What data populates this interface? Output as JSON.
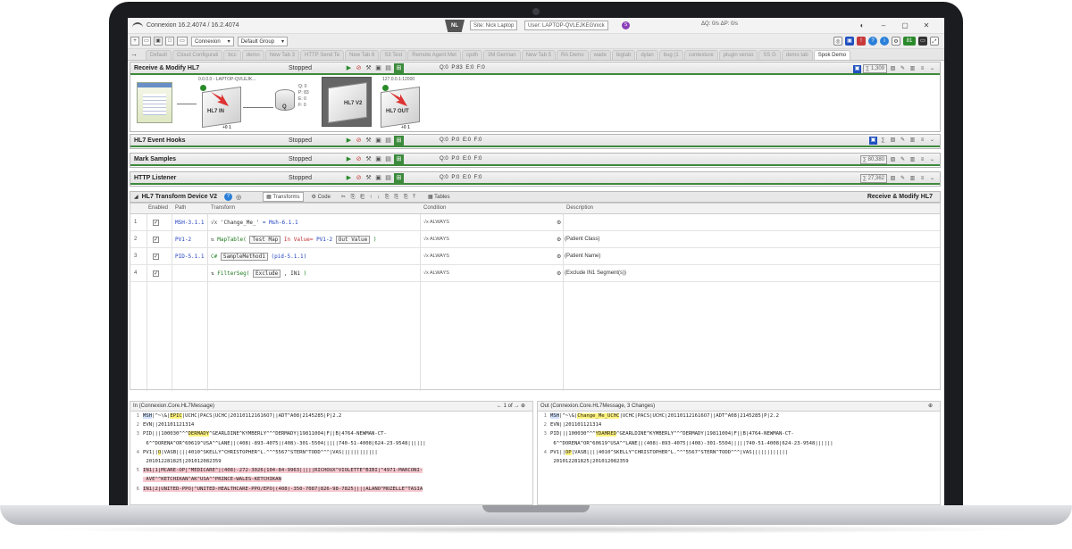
{
  "window": {
    "title": "Connexion 16.2.4074 / 16.2.4074",
    "env_badge": "NL",
    "site": "Site: Nick Laptop",
    "user": "User: LAPTOP-QVLEJKEG\\nick",
    "user_badge": "S",
    "rates": "ΔQ: 0/s   ΔP: 0/s"
  },
  "toolbar": {
    "site_select": "Connexion",
    "group_select": "Default Group"
  },
  "tabs": [
    "Default",
    "Cloud Configurati",
    "bcc",
    "demo",
    "New Tab 3",
    "HTTP Send Te",
    "New Tab 6",
    "S3 Test",
    "Remote Agent Met",
    "cpdh",
    "3M German",
    "New Tab 5",
    "RA Demo",
    "wade",
    "bigtab",
    "dylan",
    "bug (1",
    "contexture",
    "plugin versio",
    "SS G",
    "demo tab",
    "Spok Demo"
  ],
  "active_tab": "Spok Demo",
  "channels": [
    {
      "name": "Receive & Modify HL7",
      "status": "Stopped",
      "counts": "Q:0  P:83  E:0  F:0",
      "sum": "1,309",
      "flow": {
        "in_label": "0.0.0.0 - LAPTOP-QVLEJK...",
        "out_label": "127.0.0.1:12000",
        "in_text": "HL7 IN",
        "queue_text": "Q",
        "queue_stats": "Q: 0\nP: 83\nE: 0\nF: 0",
        "transform_text": "HL7 V2",
        "out_text": "HL7 OUT",
        "in_flag": "+0 1",
        "out_flag": "+0 1"
      }
    },
    {
      "name": "HL7 Event Hooks",
      "status": "Stopped",
      "counts": "Q:0  P:0  E:0  F:0",
      "sum": ""
    },
    {
      "name": "Mark Samples",
      "status": "Stopped",
      "counts": "Q:0  P:0  E:0  F:0",
      "sum": "80,380"
    },
    {
      "name": "HTTP Listener",
      "status": "Stopped",
      "counts": "Q:0  P:0  E:0  F:0",
      "sum": "27,362"
    }
  ],
  "transform_panel": {
    "title": "HL7 Transform Device V2",
    "tab_transforms": "Transforms",
    "tab_code": "Code",
    "tab_tables": "Tables",
    "channel_name": "Receive & Modify HL7",
    "columns": {
      "enabled": "Enabled",
      "path": "Path",
      "transform": "Transform",
      "condition": "Condition",
      "description": "Description"
    },
    "rows": [
      {
        "num": "1",
        "path": "MSH-3.1.1",
        "fx": "√x",
        "t1": "'Change_Me_'",
        "t2": "= Msh-6.1.1",
        "cond": "ALWAYS",
        "desc": ""
      },
      {
        "num": "2",
        "path": "PV1-2",
        "fx": "⇆",
        "t1": "MapTable(",
        "sel1": "Test Map",
        "t2": "In Value=",
        "t3": "PV1-2",
        "sel2": "Out Value",
        "t4": ")",
        "cond": "ALWAYS",
        "desc": "(Patient Class)"
      },
      {
        "num": "3",
        "path": "PID-5.1.1",
        "fx": "C#",
        "sel1": "SampleMethod1",
        "t2": "(pid-5.1.1)",
        "cond": "ALWAYS",
        "desc": "(Patient Name)"
      },
      {
        "num": "4",
        "path": "",
        "fx": "⇅",
        "t1": "FilterSeg(",
        "sel1": "Exclude",
        "t2": ", IN1 ",
        "t3": ")",
        "cond": "ALWAYS",
        "desc": "(Exclude IN1 Segment(s))"
      }
    ]
  },
  "msg_in": {
    "title": "In (Connexion.Core.HL7Message)",
    "pager": "1   of",
    "lines": [
      {
        "n": "1",
        "parts": [
          [
            "MSH",
            "blue"
          ],
          [
            "|^~\\&|",
            ""
          ],
          [
            "EPIC",
            "yellow"
          ],
          [
            "|UCHC|PACS|UCHC|201101121616O7||ADT^A08|2145285|P|2.2",
            ""
          ]
        ]
      },
      {
        "n": "2",
        "parts": [
          [
            "EVN||201101121314",
            ""
          ]
        ]
      },
      {
        "n": "3",
        "parts": [
          [
            "PID|||100030^^^",
            ""
          ],
          [
            "DERMADY",
            "yellow"
          ],
          [
            "^GEARLDINE^KYMBERLY^^^DERMADY|19811004|F||B|4764-NEWMAN-CT-",
            ""
          ]
        ]
      },
      {
        "n": "",
        "parts": [
          [
            "   6^^DORENA^OR^60619^USA^^LANE||(408)-893-4075|(408)-301-5504|||||740-51-4008|624-23-9548||||||",
            ""
          ]
        ]
      },
      {
        "n": "4",
        "parts": [
          [
            "PV1||",
            ""
          ],
          [
            "O",
            "yellow"
          ],
          [
            "|VASB||||4010^SKELLY^CHRISTOPHER^L.^^^5567^STERN^TODD^^^|VAS||||||||||||",
            ""
          ]
        ]
      },
      {
        "n": "",
        "parts": [
          [
            "   201012281825|201012082359",
            ""
          ]
        ]
      },
      {
        "n": "5",
        "parts": [
          [
            "IN1|1|MCARE-OP|^MEDICARE^|(408)-272-3026|104-84-9963|||||RICHOUX^VIOLETTE^BIBI|^4971-MARCONI-",
            "pink"
          ]
        ]
      },
      {
        "n": "",
        "parts": [
          [
            "   AVE^^KETCHIKAN^AK^USA^^PRINCE-WALES-KETCHIKAN",
            "pink"
          ]
        ]
      },
      {
        "n": "6",
        "parts": [
          [
            "IN1|2|UNITED-PPO|^UNITED-HEALTHCARE-PPO/EPO|(408)-350-7087|826-98-7825||||ALANO^MOZELLE^TASIA",
            "pink"
          ]
        ]
      }
    ]
  },
  "msg_out": {
    "title": "Out (Connexion.Core.HL7Message, 3 Changes)",
    "lines": [
      {
        "n": "1",
        "parts": [
          [
            "MSH",
            "blue"
          ],
          [
            "|^~\\&|",
            ""
          ],
          [
            "Change_Me_UCHC",
            "yellow"
          ],
          [
            "|UCHC|PACS|UCHC|201101121616O7||ADT^A08|2145285|P|2.2",
            ""
          ]
        ]
      },
      {
        "n": "2",
        "parts": [
          [
            "EVN||201101121314",
            ""
          ]
        ]
      },
      {
        "n": "3",
        "parts": [
          [
            "PID|||100030^^^",
            ""
          ],
          [
            "YDAMRED",
            "yellow"
          ],
          [
            "^GEARLDINE^KYMBERLY^^^DERMADY|19811004|F||B|4764-NEWMAN-CT-",
            ""
          ]
        ]
      },
      {
        "n": "",
        "parts": [
          [
            "   6^^DORENA^OR^60619^USA^^LANE||(408)-893-4075|(408)-301-5504|||||740-51-4008|624-23-9548||||||",
            ""
          ]
        ]
      },
      {
        "n": "4",
        "parts": [
          [
            "PV1||",
            ""
          ],
          [
            "OP",
            "yellow"
          ],
          [
            "|VASB||||4010^SKELLY^CHRISTOPHER^L.^^^5567^STERN^TODD^^^|VAS||||||||||||",
            ""
          ]
        ]
      },
      {
        "n": "",
        "parts": [
          [
            "   201012281825|201012082359",
            ""
          ]
        ]
      }
    ]
  }
}
